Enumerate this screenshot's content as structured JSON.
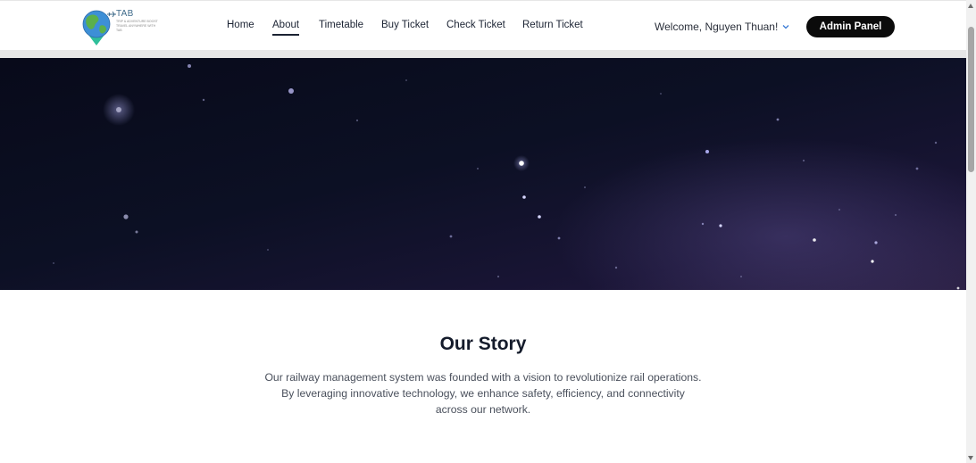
{
  "brand": {
    "name": "TAB",
    "tagline": "TRIP & ADVENTURE BOOST TRAVEL ANYWHERE WITH TAB",
    "colors": {
      "globe": "#3d8fd6",
      "land": "#5bb04b",
      "pin": "#2fbf9a"
    }
  },
  "nav": {
    "items": [
      {
        "label": "Home",
        "active": false
      },
      {
        "label": "About",
        "active": true
      },
      {
        "label": "Timetable",
        "active": false
      },
      {
        "label": "Buy Ticket",
        "active": false
      },
      {
        "label": "Check Ticket",
        "active": false
      },
      {
        "label": "Return Ticket",
        "active": false
      }
    ]
  },
  "user": {
    "welcome": "Welcome, Nguyen Thuan!",
    "dropdown_icon": "chevron-down-icon",
    "accent": "#3a7bd5"
  },
  "admin_button": {
    "label": "Admin Panel"
  },
  "hero": {
    "image": "starry-night-sky",
    "background": "#0a0c1c"
  },
  "story": {
    "title": "Our Story",
    "text": "Our railway management system was founded with a vision to revolutionize rail operations. By leveraging innovative technology, we enhance safety, efficiency, and connectivity across our network."
  }
}
